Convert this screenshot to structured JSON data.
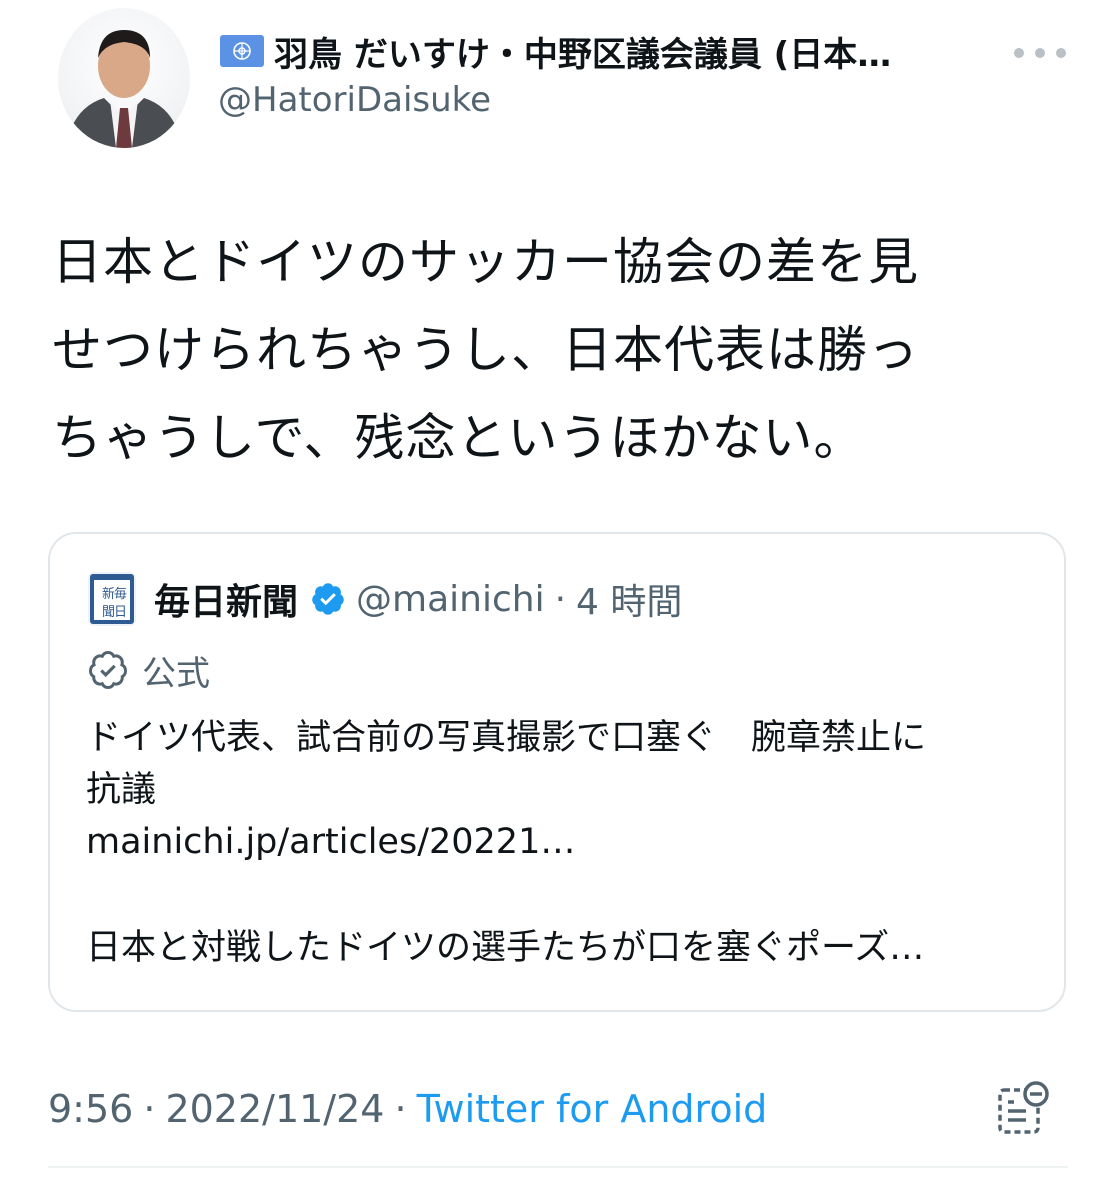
{
  "header": {
    "flag_icon": "un-flag-icon",
    "display_name": "羽鳥 だいすけ・中野区議会議員 (日本…",
    "handle": "@HatoriDaisuke"
  },
  "tweet": {
    "text_lines": [
      "日本とドイツのサッカー協会の差を見",
      "せつけられちゃうし、日本代表は勝っ",
      "ちゃうしで、残念というほかない。"
    ]
  },
  "quote": {
    "avatar_icon": "mainichi-logo",
    "name": "毎日新聞",
    "verified_icon": "verified-badge-icon",
    "handle": "@mainichi",
    "separator": "·",
    "time": "4 時間",
    "label_icon": "official-badge-icon",
    "label": "公式",
    "lines": [
      "ドイツ代表、試合前の写真撮影で口塞ぐ　腕章禁止に",
      "抗議",
      "mainichi.jp/articles/20221…",
      "",
      "日本と対戦したドイツの選手たちが口を塞ぐポーズ…"
    ]
  },
  "meta": {
    "time": "9:56",
    "separator": "·",
    "date": "2022/11/24",
    "separator2": "·",
    "source": "Twitter for Android"
  },
  "colors": {
    "text": "#0f1419",
    "secondary": "#536471",
    "link": "#1d9bf0",
    "verified": "#1d9bf0",
    "border": "#e1e6ea"
  }
}
